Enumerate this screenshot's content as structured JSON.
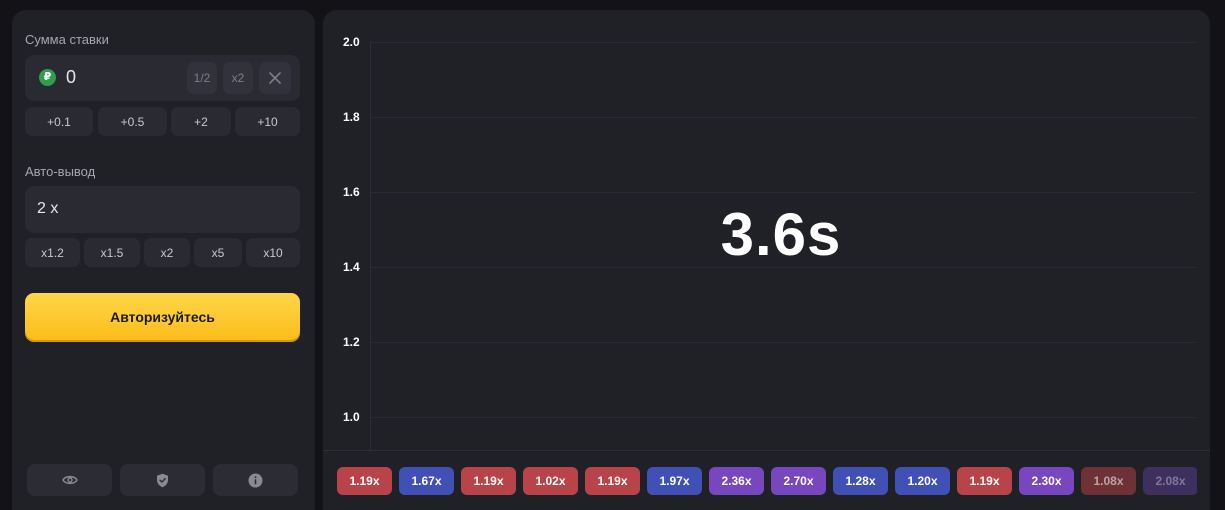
{
  "stake": {
    "label": "Сумма ставки",
    "currency_icon": "ruble-icon",
    "currency_symbol": "₽",
    "value": "0",
    "half_label": "1/2",
    "double_label": "x2",
    "clear_icon": "close-icon",
    "quick_add": [
      "+0.1",
      "+0.5",
      "+2",
      "+10"
    ]
  },
  "auto_cashout": {
    "label": "Авто-вывод",
    "value": "2 x",
    "presets": [
      "x1.2",
      "x1.5",
      "x2",
      "x5",
      "x10"
    ]
  },
  "login_button": "Авторизуйтесь",
  "footer_icons": [
    "eye-icon",
    "shield-icon",
    "info-icon"
  ],
  "game": {
    "countdown": "3.6s",
    "y_ticks": [
      "2.0",
      "1.8",
      "1.6",
      "1.4",
      "1.2",
      "1.0"
    ]
  },
  "history": [
    {
      "label": "1.19x",
      "color": "#b8444a"
    },
    {
      "label": "1.67x",
      "color": "#4150b5"
    },
    {
      "label": "1.19x",
      "color": "#b8444a"
    },
    {
      "label": "1.02x",
      "color": "#b8444a"
    },
    {
      "label": "1.19x",
      "color": "#b8444a"
    },
    {
      "label": "1.97x",
      "color": "#4150b5"
    },
    {
      "label": "2.36x",
      "color": "#7847c0"
    },
    {
      "label": "2.70x",
      "color": "#7847c0"
    },
    {
      "label": "1.28x",
      "color": "#4150b5"
    },
    {
      "label": "1.20x",
      "color": "#4150b5"
    },
    {
      "label": "1.19x",
      "color": "#b8444a"
    },
    {
      "label": "2.30x",
      "color": "#7847c0"
    },
    {
      "label": "1.08x",
      "color": "#6e3136"
    },
    {
      "label": "2.08x",
      "color": "#3d2f5e"
    }
  ],
  "colors": {
    "accent": "#fbbd1a",
    "panel": "#202027",
    "background": "#131317",
    "loss": "#b8444a",
    "mid": "#4150b5",
    "high": "#7847c0"
  }
}
